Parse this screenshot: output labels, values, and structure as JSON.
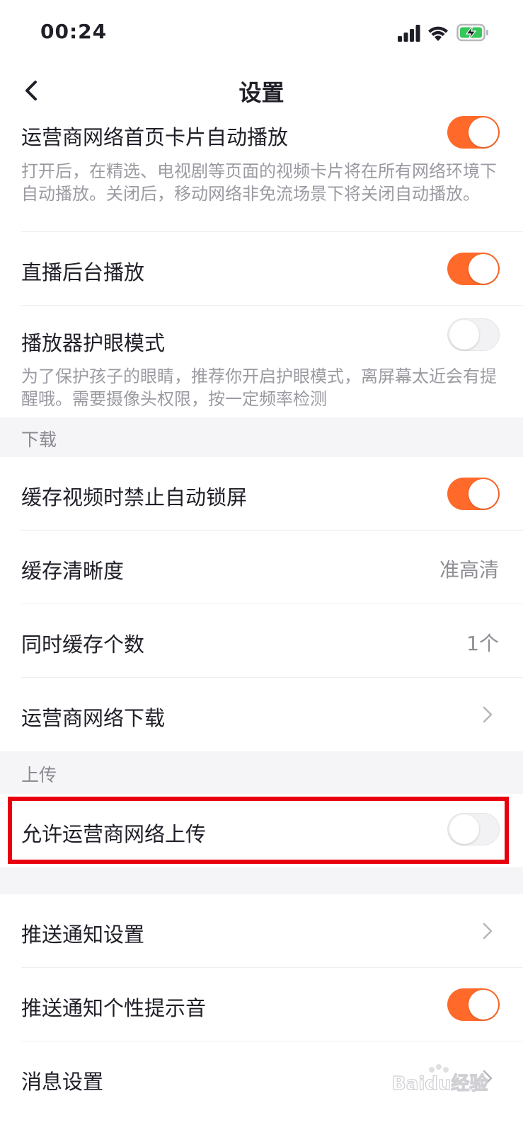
{
  "status_bar": {
    "time": "00:24",
    "icons": [
      "signal-icon",
      "wifi-icon",
      "battery-charging-icon"
    ]
  },
  "nav": {
    "title": "设置",
    "back_icon": "chevron-left-icon"
  },
  "rows": {
    "carrier_autoplay": {
      "label": "运营商网络首页卡片自动播放",
      "desc": "打开后，在精选、电视剧等页面的视频卡片将在所有网络环境下自动播放。关闭后，移动网络非免流场景下将关闭自动播放。",
      "enabled": true
    },
    "live_background": {
      "label": "直播后台播放",
      "enabled": true
    },
    "eye_care": {
      "label": "播放器护眼模式",
      "desc": "为了保护孩子的眼睛，推荐你开启护眼模式，离屏幕太近会有提醒哦。需要摄像头权限，按一定频率检测",
      "enabled": false
    },
    "no_autolock": {
      "label": "缓存视频时禁止自动锁屏",
      "enabled": true
    },
    "cache_quality": {
      "label": "缓存清晰度",
      "value": "准高清"
    },
    "cache_count": {
      "label": "同时缓存个数",
      "value": "1个"
    },
    "carrier_download": {
      "label": "运营商网络下载"
    },
    "carrier_upload": {
      "label": "允许运营商网络上传",
      "enabled": false
    },
    "push_settings": {
      "label": "推送通知设置"
    },
    "push_sound": {
      "label": "推送通知个性提示音",
      "enabled": true
    },
    "message_settings": {
      "label": "消息设置"
    }
  },
  "sections": {
    "download": "下载",
    "upload": "上传"
  },
  "colors": {
    "accent": "#ff6a2b",
    "highlight": "#e8000e",
    "section_bg": "#f5f5f7"
  },
  "watermark": {
    "text": "Baidu经验"
  }
}
